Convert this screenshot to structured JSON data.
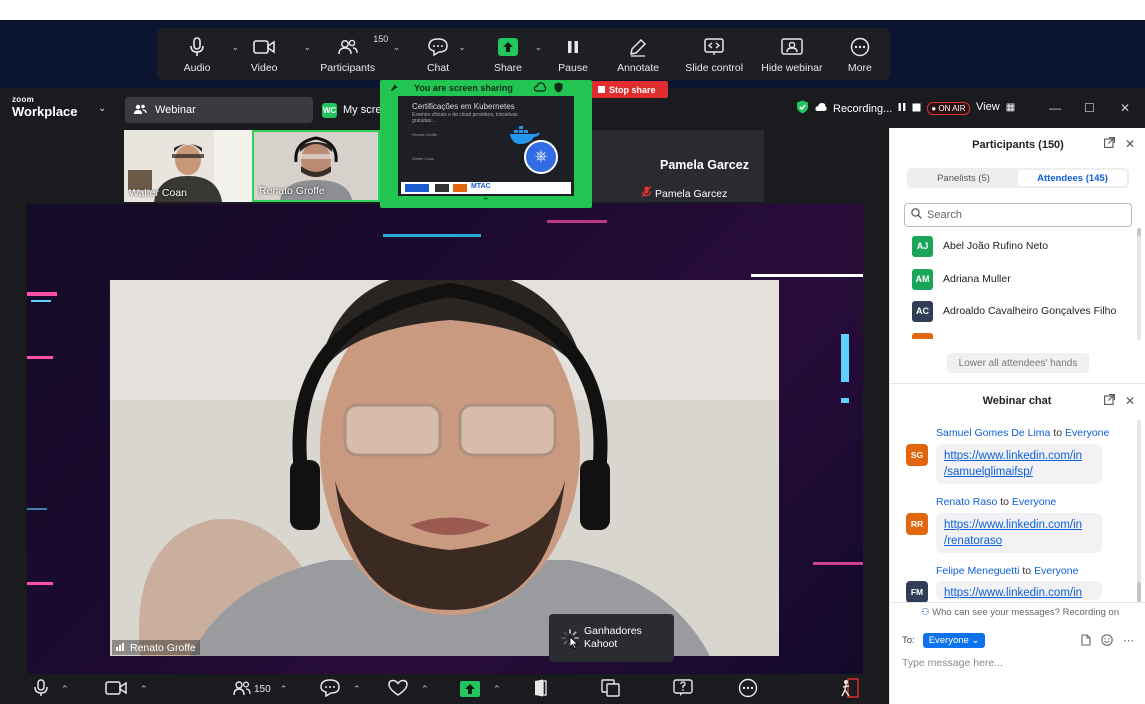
{
  "share_toolbar": {
    "audio": "Audio",
    "video": "Video",
    "participants": "Participants",
    "participants_count": "150",
    "chat": "Chat",
    "share": "Share",
    "pause": "Pause",
    "annotate": "Annotate",
    "slide_control": "Slide control",
    "hide_webinar": "Hide webinar",
    "more": "More"
  },
  "app": {
    "logo_small": "zoom",
    "logo_big": "Workplace",
    "tab_webinar": "Webinar",
    "tab_myscreen_badge": "WC",
    "tab_myscreen": "My scree",
    "recording": "Recording...",
    "on_air": "ON AIR",
    "view": "View"
  },
  "screen_share": {
    "banner": "You are screen sharing",
    "stop": "Stop share",
    "slide_title": "Certificações em Kubernetes",
    "slide_subtitle": "Exames oficiais e de cloud providers, iniciativas gratuitas...",
    "slide_p1_name": "Renato Groffe",
    "slide_p2_name": "Walter Coan",
    "slide_logo": "MTAC"
  },
  "gallery": [
    {
      "name": "Walter Coan"
    },
    {
      "name": "Renato Groffe"
    },
    {
      "name": "Pamela Garcez"
    }
  ],
  "main_video": {
    "name": "Renato Groffe"
  },
  "tooltip": {
    "line1": "Ganhadores",
    "line2": "Kahoot"
  },
  "bottom_bar": {
    "participants_count": "150"
  },
  "participants_panel": {
    "title": "Participants (150)",
    "tab_panelists": "Panelists (5)",
    "tab_attendees": "Attendees (145)",
    "search_placeholder": "Search",
    "attendees": [
      {
        "initials": "AJ",
        "name": "Abel João Rufino Neto",
        "color": "#1aa55a"
      },
      {
        "initials": "AM",
        "name": "Adriana Muller",
        "color": "#1aa55a"
      },
      {
        "initials": "AC",
        "name": "Adroaldo Cavalheiro Gonçalves Filho",
        "color": "#2f3e55"
      }
    ],
    "lower_hands": "Lower all attendees' hands"
  },
  "chat_panel": {
    "title": "Webinar chat",
    "to_word": "to",
    "messages": [
      {
        "initials": "SG",
        "sender": "Samuel Gomes De Lima",
        "recipient": "Everyone",
        "link1": "https://www.linkedin.com/in",
        "link2": "/samuelglimaifsp/",
        "color": "#e2660f"
      },
      {
        "initials": "RR",
        "sender": "Renato Raso",
        "recipient": "Everyone",
        "link1": "https://www.linkedin.com/in",
        "link2": "/renatoraso",
        "color": "#e2660f"
      },
      {
        "initials": "FM",
        "sender": "Felipe Meneguetti",
        "recipient": "Everyone",
        "link1": "https://www.linkedin.com/in",
        "link2": "",
        "color": "#2f3e55"
      }
    ],
    "who_can_see": "Who can see your messages? Recording on",
    "to_label": "To:",
    "to_value": "Everyone",
    "input_placeholder": "Type message here..."
  },
  "colors": {
    "accent": "#0e72ed",
    "share_green": "#23c552",
    "stop_red": "#e02d2d"
  }
}
